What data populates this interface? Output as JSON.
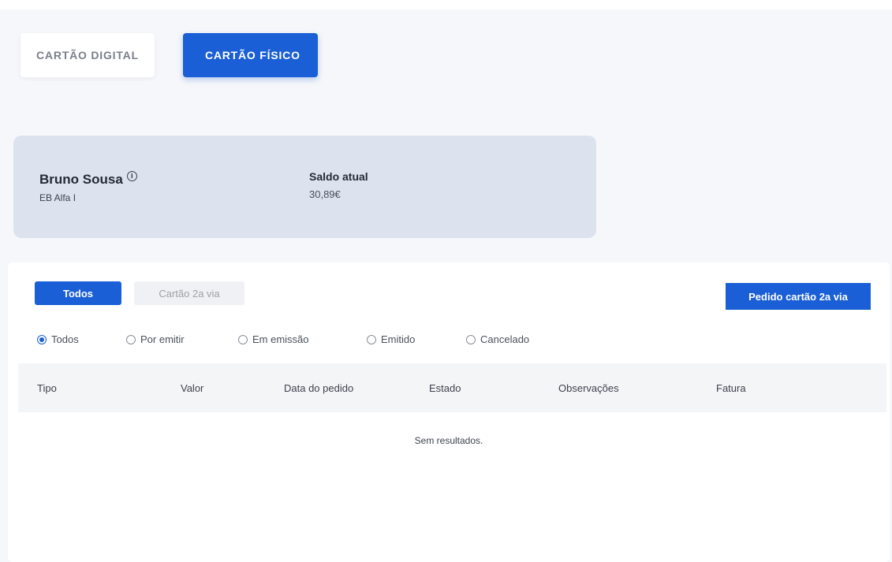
{
  "top_tabs": {
    "digital": "CARTÃO DIGITAL",
    "fisico": "CARTÃO FÍSICO"
  },
  "card": {
    "holder_name": "Bruno Sousa",
    "school": "EB Alfa I",
    "balance_label": "Saldo atual",
    "balance_value": "30,89€",
    "info_icon_glyph": "①"
  },
  "filters": {
    "todos": "Todos",
    "segunda_via": "Cartão 2a via"
  },
  "request_button": "Pedido cartão 2a via",
  "status_radios": [
    {
      "label": "Todos",
      "checked": true
    },
    {
      "label": "Por emitir",
      "checked": false
    },
    {
      "label": "Em emissão",
      "checked": false
    },
    {
      "label": "Emitido",
      "checked": false
    },
    {
      "label": "Cancelado",
      "checked": false
    }
  ],
  "table": {
    "columns": [
      "Tipo",
      "Valor",
      "Data do pedido",
      "Estado",
      "Observações",
      "Fatura"
    ],
    "empty_message": "Sem resultados."
  },
  "colors": {
    "accent": "#1a5fd6",
    "card_bg": "#dde3ee",
    "page_bg": "#f6f7fa"
  }
}
